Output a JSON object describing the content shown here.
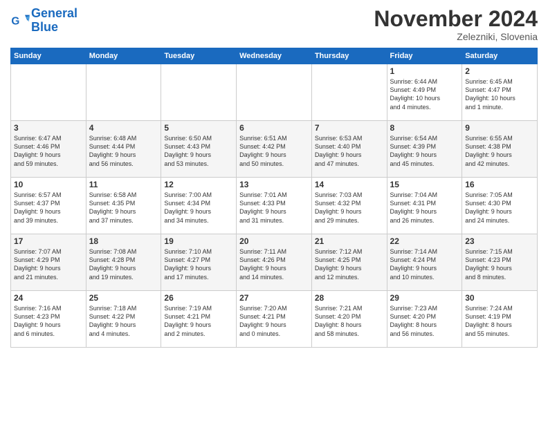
{
  "header": {
    "logo_line1": "General",
    "logo_line2": "Blue",
    "month": "November 2024",
    "location": "Zelezniki, Slovenia"
  },
  "weekdays": [
    "Sunday",
    "Monday",
    "Tuesday",
    "Wednesday",
    "Thursday",
    "Friday",
    "Saturday"
  ],
  "weeks": [
    [
      {
        "day": "",
        "info": ""
      },
      {
        "day": "",
        "info": ""
      },
      {
        "day": "",
        "info": ""
      },
      {
        "day": "",
        "info": ""
      },
      {
        "day": "",
        "info": ""
      },
      {
        "day": "1",
        "info": "Sunrise: 6:44 AM\nSunset: 4:49 PM\nDaylight: 10 hours\nand 4 minutes."
      },
      {
        "day": "2",
        "info": "Sunrise: 6:45 AM\nSunset: 4:47 PM\nDaylight: 10 hours\nand 1 minute."
      }
    ],
    [
      {
        "day": "3",
        "info": "Sunrise: 6:47 AM\nSunset: 4:46 PM\nDaylight: 9 hours\nand 59 minutes."
      },
      {
        "day": "4",
        "info": "Sunrise: 6:48 AM\nSunset: 4:44 PM\nDaylight: 9 hours\nand 56 minutes."
      },
      {
        "day": "5",
        "info": "Sunrise: 6:50 AM\nSunset: 4:43 PM\nDaylight: 9 hours\nand 53 minutes."
      },
      {
        "day": "6",
        "info": "Sunrise: 6:51 AM\nSunset: 4:42 PM\nDaylight: 9 hours\nand 50 minutes."
      },
      {
        "day": "7",
        "info": "Sunrise: 6:53 AM\nSunset: 4:40 PM\nDaylight: 9 hours\nand 47 minutes."
      },
      {
        "day": "8",
        "info": "Sunrise: 6:54 AM\nSunset: 4:39 PM\nDaylight: 9 hours\nand 45 minutes."
      },
      {
        "day": "9",
        "info": "Sunrise: 6:55 AM\nSunset: 4:38 PM\nDaylight: 9 hours\nand 42 minutes."
      }
    ],
    [
      {
        "day": "10",
        "info": "Sunrise: 6:57 AM\nSunset: 4:37 PM\nDaylight: 9 hours\nand 39 minutes."
      },
      {
        "day": "11",
        "info": "Sunrise: 6:58 AM\nSunset: 4:35 PM\nDaylight: 9 hours\nand 37 minutes."
      },
      {
        "day": "12",
        "info": "Sunrise: 7:00 AM\nSunset: 4:34 PM\nDaylight: 9 hours\nand 34 minutes."
      },
      {
        "day": "13",
        "info": "Sunrise: 7:01 AM\nSunset: 4:33 PM\nDaylight: 9 hours\nand 31 minutes."
      },
      {
        "day": "14",
        "info": "Sunrise: 7:03 AM\nSunset: 4:32 PM\nDaylight: 9 hours\nand 29 minutes."
      },
      {
        "day": "15",
        "info": "Sunrise: 7:04 AM\nSunset: 4:31 PM\nDaylight: 9 hours\nand 26 minutes."
      },
      {
        "day": "16",
        "info": "Sunrise: 7:05 AM\nSunset: 4:30 PM\nDaylight: 9 hours\nand 24 minutes."
      }
    ],
    [
      {
        "day": "17",
        "info": "Sunrise: 7:07 AM\nSunset: 4:29 PM\nDaylight: 9 hours\nand 21 minutes."
      },
      {
        "day": "18",
        "info": "Sunrise: 7:08 AM\nSunset: 4:28 PM\nDaylight: 9 hours\nand 19 minutes."
      },
      {
        "day": "19",
        "info": "Sunrise: 7:10 AM\nSunset: 4:27 PM\nDaylight: 9 hours\nand 17 minutes."
      },
      {
        "day": "20",
        "info": "Sunrise: 7:11 AM\nSunset: 4:26 PM\nDaylight: 9 hours\nand 14 minutes."
      },
      {
        "day": "21",
        "info": "Sunrise: 7:12 AM\nSunset: 4:25 PM\nDaylight: 9 hours\nand 12 minutes."
      },
      {
        "day": "22",
        "info": "Sunrise: 7:14 AM\nSunset: 4:24 PM\nDaylight: 9 hours\nand 10 minutes."
      },
      {
        "day": "23",
        "info": "Sunrise: 7:15 AM\nSunset: 4:23 PM\nDaylight: 9 hours\nand 8 minutes."
      }
    ],
    [
      {
        "day": "24",
        "info": "Sunrise: 7:16 AM\nSunset: 4:23 PM\nDaylight: 9 hours\nand 6 minutes."
      },
      {
        "day": "25",
        "info": "Sunrise: 7:18 AM\nSunset: 4:22 PM\nDaylight: 9 hours\nand 4 minutes."
      },
      {
        "day": "26",
        "info": "Sunrise: 7:19 AM\nSunset: 4:21 PM\nDaylight: 9 hours\nand 2 minutes."
      },
      {
        "day": "27",
        "info": "Sunrise: 7:20 AM\nSunset: 4:21 PM\nDaylight: 9 hours\nand 0 minutes."
      },
      {
        "day": "28",
        "info": "Sunrise: 7:21 AM\nSunset: 4:20 PM\nDaylight: 8 hours\nand 58 minutes."
      },
      {
        "day": "29",
        "info": "Sunrise: 7:23 AM\nSunset: 4:20 PM\nDaylight: 8 hours\nand 56 minutes."
      },
      {
        "day": "30",
        "info": "Sunrise: 7:24 AM\nSunset: 4:19 PM\nDaylight: 8 hours\nand 55 minutes."
      }
    ]
  ]
}
